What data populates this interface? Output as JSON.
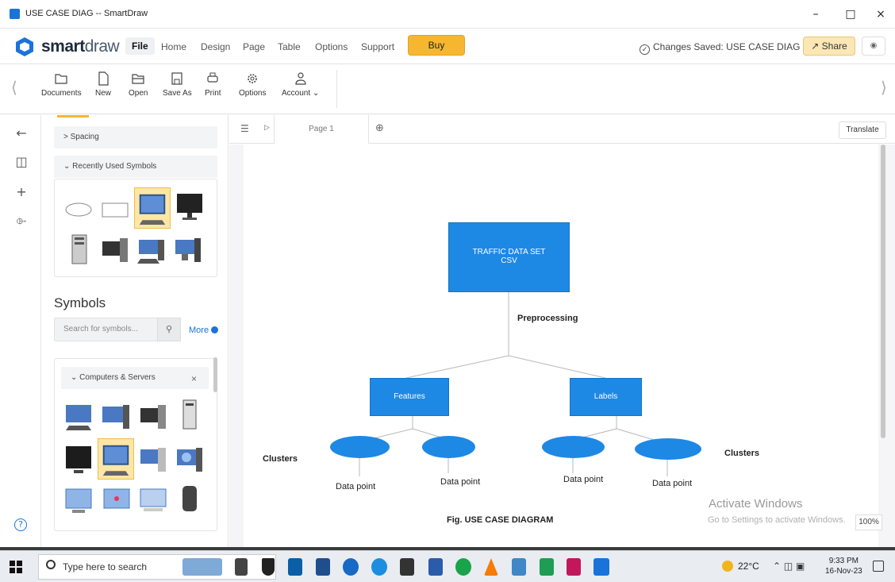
{
  "window": {
    "title": "USE CASE DIAG -- SmartDraw"
  },
  "menubar": {
    "logo_a": "smart",
    "logo_b": "draw",
    "items": [
      "File",
      "Home",
      "Design",
      "Page",
      "Table",
      "Options",
      "Support"
    ],
    "buy": "Buy",
    "status": "Changes Saved: USE CASE DIAG",
    "share": "Share"
  },
  "toolbar": {
    "buttons": [
      "Documents",
      "New",
      "Open",
      "Save As",
      "Print",
      "Options",
      "Account ⌄"
    ]
  },
  "panel": {
    "spacing": "> Spacing",
    "recent": "⌄ Recently Used Symbols",
    "symbols_title": "Symbols",
    "search_placeholder": "Search for symbols...",
    "more": "More",
    "library": "⌄ Computers & Servers",
    "library_close": "×"
  },
  "canvas": {
    "page_tab": "Page 1",
    "translate": "Translate",
    "zoom": "100%"
  },
  "diagram": {
    "root": [
      "TRAFFIC DATA SET",
      "CSV"
    ],
    "edge_label": "Preprocessing",
    "features": "Features",
    "labels": "Labels",
    "clusters_left": "Clusters",
    "clusters_right": "Clusters",
    "datapoints": [
      "Data point",
      "Data point",
      "Data point",
      "Data point"
    ],
    "caption": "Fig.  USE CASE DIAGRAM"
  },
  "watermark": {
    "line1": "Activate Windows",
    "line2": "Go to Settings to activate Windows."
  },
  "taskbar": {
    "search": "Type here to search",
    "weather": "22°C",
    "time": "9:33 PM",
    "date": "16-Nov-23"
  },
  "colors": {
    "accent": "#1e88e5",
    "buy": "#f6b630",
    "brand": "#1a73d9"
  }
}
